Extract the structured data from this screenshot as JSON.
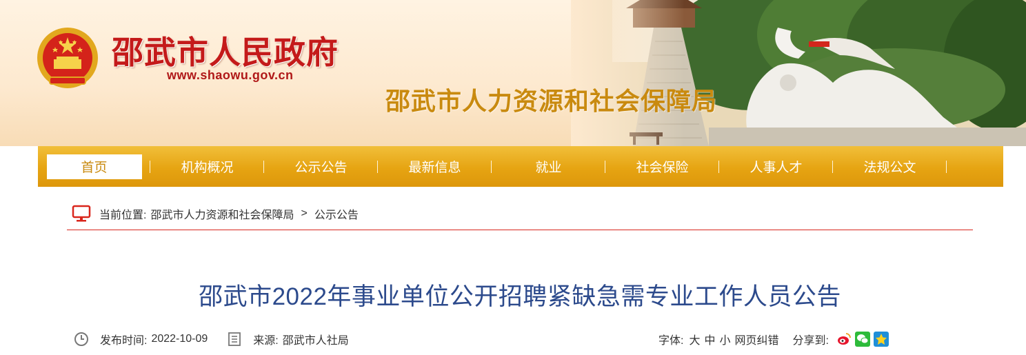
{
  "header": {
    "gov_title": "邵武市人民政府",
    "gov_url": "www.shaowu.gov.cn",
    "bureau_title": "邵武市人力资源和社会保障局",
    "emblem_icon": "national-emblem-icon"
  },
  "nav": {
    "items": [
      {
        "label": "首页",
        "active": true
      },
      {
        "label": "机构概况"
      },
      {
        "label": "公示公告"
      },
      {
        "label": "最新信息"
      },
      {
        "label": "就业"
      },
      {
        "label": "社会保险"
      },
      {
        "label": "人事人才"
      },
      {
        "label": "法规公文"
      }
    ]
  },
  "breadcrumb": {
    "prefix": "当前位置:",
    "items": [
      "邵武市人力资源和社会保障局",
      "公示公告"
    ],
    "separator": ">"
  },
  "article": {
    "title": "邵武市2022年事业单位公开招聘紧缺急需专业工作人员公告",
    "publish_label": "发布时间:",
    "publish_date": "2022-10-09",
    "source_label": "来源:",
    "source": "邵武市人社局",
    "font_label": "字体:",
    "font_sizes": [
      "大",
      "中",
      "小"
    ],
    "error_link": "网页纠错",
    "share_label": "分享到:"
  },
  "colors": {
    "nav_gold": "#e6a412",
    "gov_red": "#c41a1a",
    "bureau_gold": "#c98a0f",
    "title_blue": "#2c4a8c",
    "rule_red": "#d9261c"
  }
}
